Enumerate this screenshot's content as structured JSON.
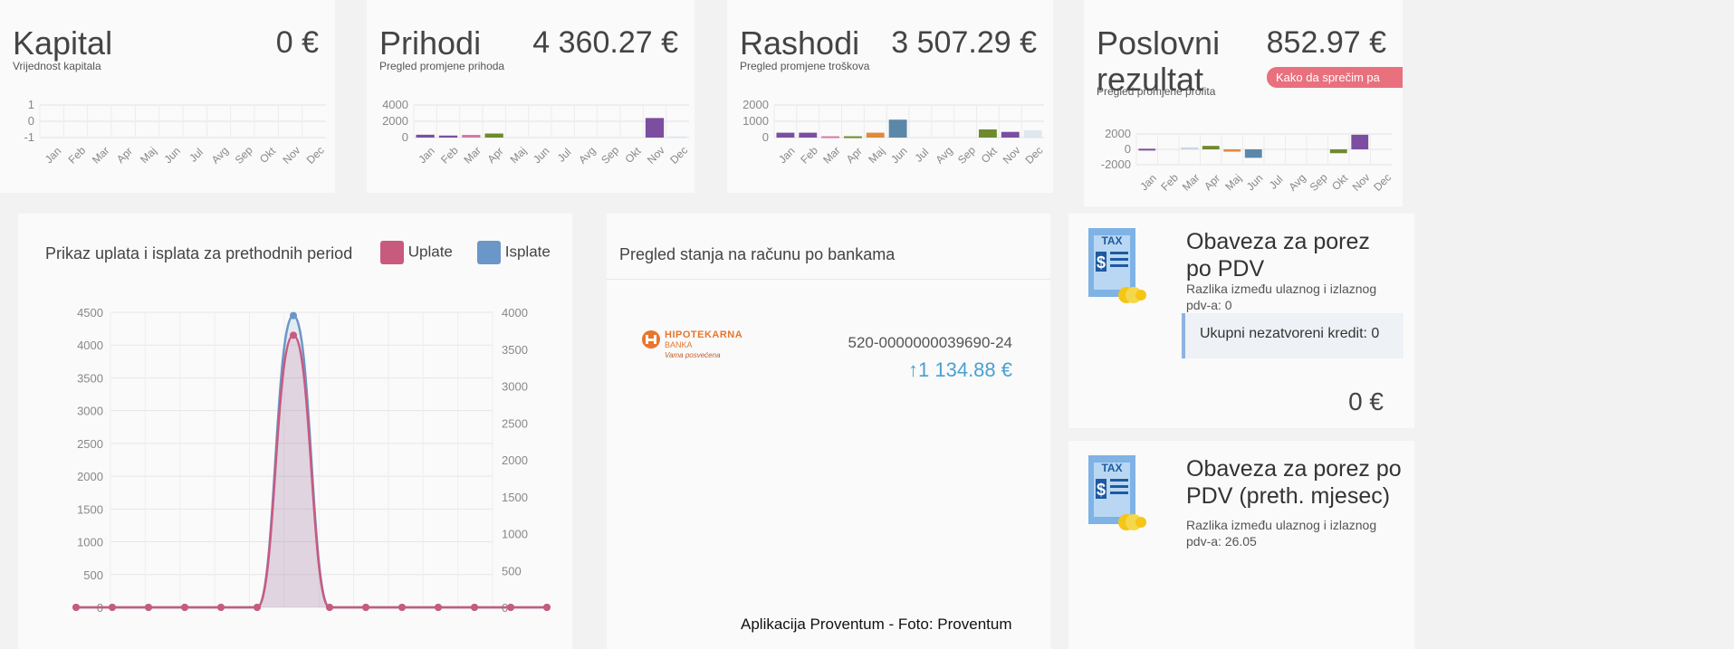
{
  "kpis": [
    {
      "title": "Kapital",
      "value": "0 €",
      "subtitle": "Vrijednost kapitala",
      "ticks": [
        "1",
        "0",
        "-1"
      ]
    },
    {
      "title": "Prihodi",
      "value": "4 360.27 €",
      "subtitle": "Pregled promjene prihoda",
      "ticks": [
        "4000",
        "2000",
        "0"
      ]
    },
    {
      "title": "Rashodi",
      "value": "3 507.29 €",
      "subtitle": "Pregled promjene troškova",
      "ticks": [
        "2000",
        "1000",
        "0"
      ]
    },
    {
      "title_line1": "Poslovni",
      "title_line2": "rezultat",
      "value": "852.97 €",
      "subtitle": "Pregled promjene profita",
      "badge": "Kako da sprečim pa",
      "ticks": [
        "2000",
        "0",
        "-2000"
      ]
    }
  ],
  "months": [
    "Jan",
    "Feb",
    "Mar",
    "Apr",
    "Maj",
    "Jun",
    "Jul",
    "Avg",
    "Sep",
    "Okt",
    "Nov",
    "Dec"
  ],
  "colors": {
    "uplate": "#c85a7e",
    "isplate": "#6b96c8",
    "purple": "#7b4ea0",
    "green": "#6f8a2e",
    "pink": "#d877a6",
    "blue": "#5b87a8",
    "orange": "#e08a3a",
    "accent": "#4aa0d0",
    "badge": "#e9707d"
  },
  "payments": {
    "title": "Prikaz uplata i isplata za prethodnih period",
    "legend_uplate": "Uplate",
    "legend_isplate": "Isplate",
    "left_ticks": [
      "4500",
      "4000",
      "3500",
      "3000",
      "2500",
      "2000",
      "1500",
      "1000",
      "500",
      "0"
    ],
    "right_ticks": [
      "4000",
      "3500",
      "3000",
      "2500",
      "2000",
      "1500",
      "1000",
      "500",
      "0"
    ]
  },
  "bank": {
    "title": "Pregled stanja na računu po bankama",
    "bank_name": "HIPOTEKARNA",
    "bank_sub": "BANKA",
    "bank_slogan": "Vama posvećena",
    "account": "520-0000000039690-24",
    "balance": "1 134.88 €"
  },
  "tax1": {
    "icon_label": "TAX",
    "title": "Obaveza za porez po PDV",
    "subtitle": "Razlika između ulaznog i izlaznog pdv-a: 0",
    "credit": "Ukupni nezatvoreni kredit: 0",
    "amount": "0 €"
  },
  "tax2": {
    "icon_label": "TAX",
    "title": "Obaveza za porez po PDV (preth. mjesec)",
    "subtitle": "Razlika između ulaznog i izlaznog pdv-a: 26.05"
  },
  "caption": "Aplikacija Proventum - Foto: Proventum",
  "chart_data": [
    {
      "type": "line",
      "title": "Prikaz uplata i isplata za prethodnih period",
      "x": [
        "1",
        "2",
        "3",
        "4",
        "5",
        "6",
        "7",
        "8",
        "9",
        "10",
        "11",
        "12",
        "13",
        "14"
      ],
      "series": [
        {
          "name": "Uplate",
          "values": [
            0,
            0,
            0,
            0,
            0,
            0,
            4150,
            0,
            0,
            0,
            0,
            0,
            0,
            0
          ]
        },
        {
          "name": "Isplate",
          "values": [
            0,
            0,
            0,
            0,
            0,
            0,
            4450,
            0,
            0,
            0,
            0,
            0,
            0,
            0
          ]
        }
      ],
      "ylim": [
        0,
        4500
      ],
      "y2lim": [
        0,
        4000
      ]
    },
    {
      "type": "bar",
      "title": "Prihodi",
      "categories": [
        "Jan",
        "Feb",
        "Mar",
        "Apr",
        "Maj",
        "Jun",
        "Jul",
        "Avg",
        "Sep",
        "Okt",
        "Nov",
        "Dec"
      ],
      "values": [
        350,
        250,
        330,
        500,
        0,
        0,
        0,
        0,
        0,
        0,
        2400,
        150
      ],
      "ylim": [
        0,
        4000
      ]
    },
    {
      "type": "bar",
      "title": "Rashodi",
      "categories": [
        "Jan",
        "Feb",
        "Mar",
        "Apr",
        "Maj",
        "Jun",
        "Jul",
        "Avg",
        "Sep",
        "Okt",
        "Nov",
        "Dec"
      ],
      "values": [
        300,
        300,
        80,
        80,
        300,
        1100,
        0,
        0,
        0,
        500,
        350,
        450
      ],
      "ylim": [
        0,
        2000
      ]
    },
    {
      "type": "bar",
      "title": "Poslovni rezultat",
      "categories": [
        "Jan",
        "Feb",
        "Mar",
        "Apr",
        "Maj",
        "Jun",
        "Jul",
        "Avg",
        "Sep",
        "Okt",
        "Nov",
        "Dec"
      ],
      "values": [
        80,
        0,
        250,
        450,
        -300,
        -1100,
        0,
        0,
        0,
        -500,
        1900,
        0
      ],
      "ylim": [
        -2000,
        2000
      ]
    }
  ]
}
